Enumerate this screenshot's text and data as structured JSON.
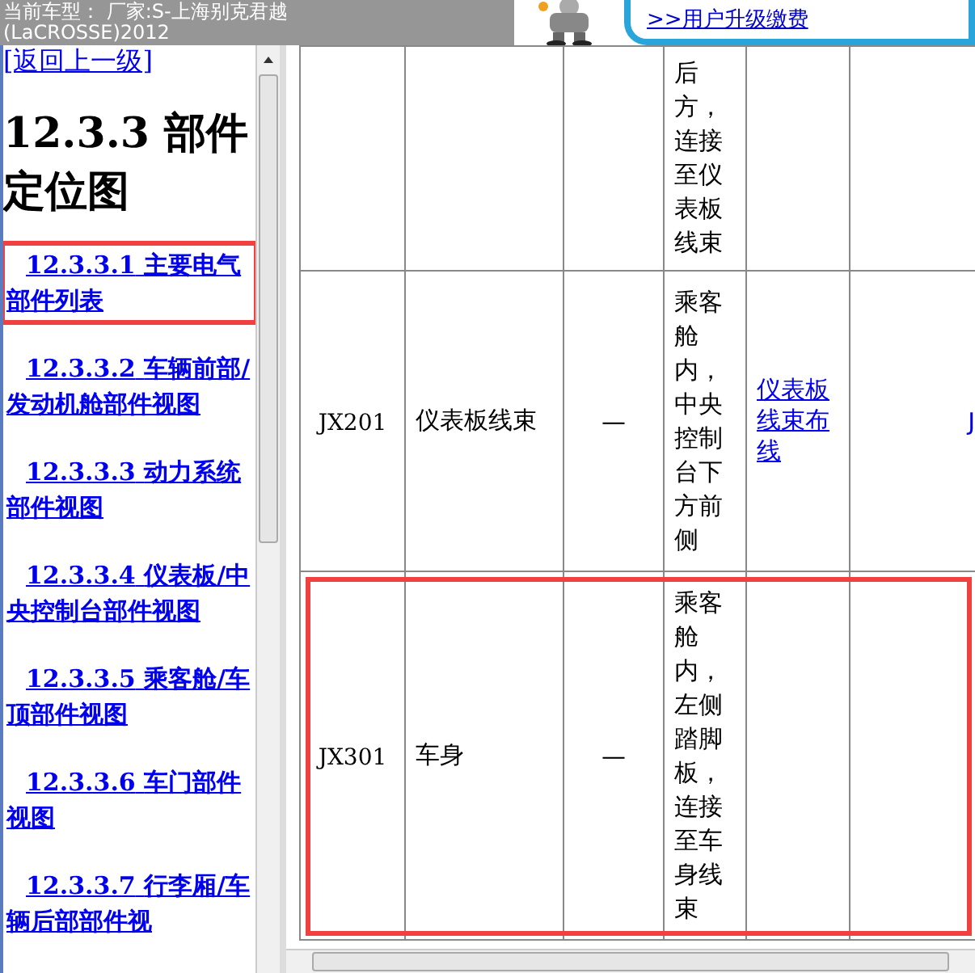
{
  "banner": {
    "car_model": "当前车型： 厂家:S-上海别克君越",
    "car_model_line2": "(LaCROSSE)2012",
    "upgrade_link": ">>用户升级缴费"
  },
  "nav": {
    "back_link": "[返回上一级]",
    "heading": "12.3.3 部件定位图",
    "items": [
      {
        "number": "12.3.3.1",
        "label": "主要电气部件列表",
        "selected": true
      },
      {
        "number": "12.3.3.2",
        "label": "车辆前部/发动机舱部件视图",
        "selected": false
      },
      {
        "number": "12.3.3.3",
        "label": "动力系统部件视图",
        "selected": false
      },
      {
        "number": "12.3.3.4",
        "label": "仪表板/中央控制台部件视图",
        "selected": false
      },
      {
        "number": "12.3.3.5",
        "label": "乘客舱/车顶部件视图",
        "selected": false
      },
      {
        "number": "12.3.3.6",
        "label": "车门部件视图",
        "selected": false
      },
      {
        "number": "12.3.3.7",
        "label": "行李厢/车辆后部部件视",
        "selected": false
      }
    ]
  },
  "table": {
    "rows": [
      {
        "code": "",
        "name": "",
        "option": "",
        "location": "后方，连接至仪表板线束",
        "link": "",
        "link_2": "",
        "selected": false
      },
      {
        "code": "JX201",
        "name": "仪表板线束",
        "option": "—",
        "location": "乘客舱内，中央控制台下方前侧",
        "link": "仪表板线束布线",
        "link_2": "J",
        "selected": false
      },
      {
        "code": "JX301",
        "name": "车身",
        "option": "—",
        "location": "乘客舱内，左侧踏脚板，连接至车身线束",
        "link": "",
        "link_2": "",
        "selected": true
      }
    ]
  }
}
